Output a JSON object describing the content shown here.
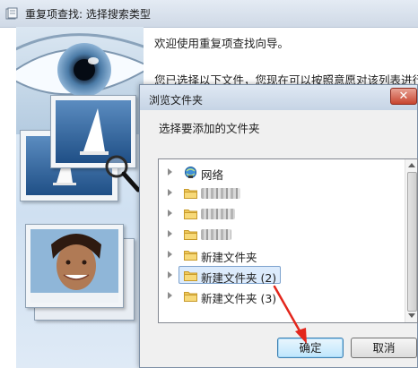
{
  "wizard": {
    "title": "重复项查找: 选择搜索类型",
    "welcome": "欢迎使用重复项查找向导。",
    "selected_files_text": "您已选择以下文件，您现在可以按照意愿对该列表进行修"
  },
  "dialog": {
    "title": "浏览文件夹",
    "close_glyph": "✕",
    "instruction": "选择要添加的文件夹",
    "tree_items": [
      {
        "label": "网络",
        "icon": "network-icon"
      },
      {
        "label": "",
        "icon": "folder-icon",
        "redacted": true
      },
      {
        "label": "",
        "icon": "folder-icon",
        "redacted": true
      },
      {
        "label": "",
        "icon": "folder-icon",
        "redacted": true
      },
      {
        "label": "新建文件夹",
        "icon": "folder-icon"
      },
      {
        "label": "新建文件夹 (2)",
        "icon": "folder-icon",
        "selected": true
      },
      {
        "label": "新建文件夹 (3)",
        "icon": "folder-icon"
      }
    ],
    "ok_label": "确定",
    "cancel_label": "取消"
  },
  "colors": {
    "annotation_arrow": "#e3261c",
    "selection": "#dcebfc",
    "close_button": "#c7452f"
  }
}
